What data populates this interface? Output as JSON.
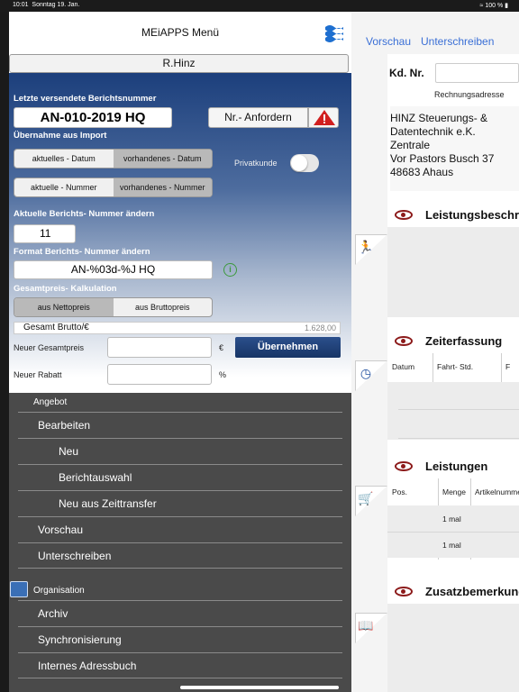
{
  "statusbar": {
    "time": "10:01",
    "date": "Sonntag 19. Jan.",
    "battery": "100 %"
  },
  "left": {
    "title": "MEiAPPS Menü",
    "user": "R.Hinz",
    "last_report_label": "Letzte versendete Berichtsnummer",
    "report_number": "AN-010-2019 HQ",
    "request_button": "Nr.- Anfordern",
    "import_label": "Übernahme aus Import",
    "seg_date": [
      "aktuelles - Datum",
      "vorhandenes - Datum"
    ],
    "seg_number": [
      "aktuelle - Nummer",
      "vorhandenes - Nummer"
    ],
    "privatkunde": "Privatkunde",
    "change_nr_label": "Aktuelle Berichts- Nummer ändern",
    "current_number": "11",
    "format_label": "Format Berichts- Nummer ändern",
    "format_value": "AN-%03d-%J HQ",
    "calc_label": "Gesamtpreis- Kalkulation",
    "seg_price": [
      "aus Nettopreis",
      "aus Bruttopreis"
    ],
    "total_label": "Gesamt Brutto/€",
    "total_value": "1.628,00",
    "new_total_label": "Neuer Gesamtpreis",
    "currency": "€",
    "apply_button": "Übernehmen",
    "new_discount_label": "Neuer Rabatt",
    "percent": "%"
  },
  "menu": {
    "section1": "Angebot",
    "bearbeiten": "Bearbeiten",
    "neu": "Neu",
    "berichtauswahl": "Berichtauswahl",
    "neu_zeit": "Neu aus Zeittransfer",
    "vorschau": "Vorschau",
    "unterschreiben": "Unterschreiben",
    "section2": "Organisation",
    "archiv": "Archiv",
    "sync": "Synchronisierung",
    "adressbuch": "Internes Adressbuch"
  },
  "right": {
    "vorschau": "Vorschau",
    "unterschreiben": "Unterschreiben",
    "kd_label": "Kd. Nr.",
    "billing_label": "Rechnungsadresse",
    "address": [
      "HINZ Steuerungs- &",
      "Datentechnik e.K.",
      "Zentrale",
      "Vor Pastors Busch 37",
      "48683 Ahaus"
    ],
    "sec_leistungsbeschreibung": "Leistungsbeschreibung",
    "sec_zeiterfassung": "Zeiterfassung",
    "zeit_cols": [
      "Datum",
      "Fahrt- Std.",
      "F"
    ],
    "sec_leistungen": "Leistungen",
    "leist_cols": [
      "Pos.",
      "Menge",
      "Artikelnummer"
    ],
    "leist_rows": [
      "1 mal",
      "1 mal"
    ],
    "sec_zusatz": "Zusatzbemerkungen"
  },
  "colors": {
    "accent": "#3a6fd6",
    "navy": "#1c3f7c",
    "eye": "#8c1a1a",
    "menu_bg": "#4a4a4a"
  }
}
